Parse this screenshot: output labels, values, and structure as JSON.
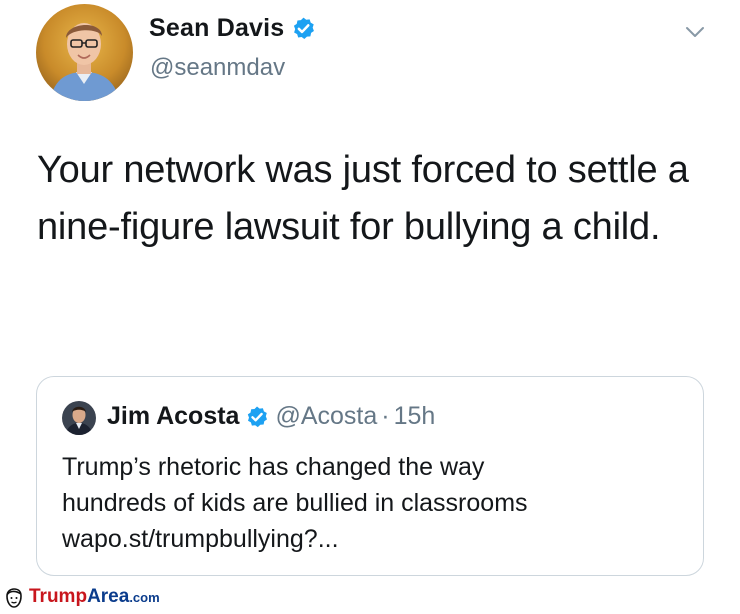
{
  "tweet": {
    "author_name": "Sean Davis",
    "author_handle": "@seanmdav",
    "text": "Your network was just forced to settle a nine-figure lawsuit for bullying a child."
  },
  "quoted_tweet": {
    "author_name": "Jim Acosta",
    "author_handle": "@Acosta",
    "separator": "·",
    "time": "15h",
    "lines": [
      "Trump’s rhetoric has changed the way",
      "hundreds of kids are bullied in classrooms",
      "wapo.st/trumpbullying?..."
    ]
  },
  "watermark": {
    "part1": "Trump",
    "part2": "Area",
    "part3": ".com"
  },
  "icons": {
    "verified": "verified-badge-icon",
    "menu": "chevron-down-icon",
    "watermark": "face-icon"
  },
  "colors": {
    "verified_blue": "#1da1f2",
    "secondary_text": "#657786",
    "watermark_red": "#c8161d",
    "watermark_blue": "#0b3c8c"
  }
}
